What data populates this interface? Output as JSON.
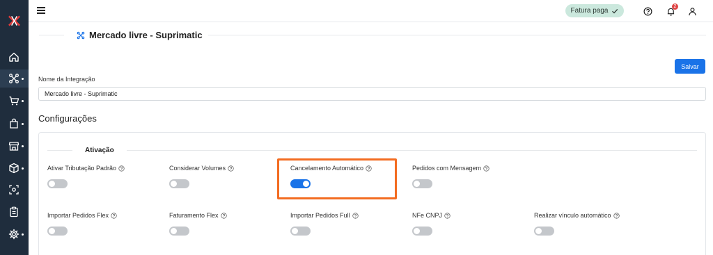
{
  "sidebar": {
    "logo": "x-logo",
    "items": [
      {
        "icon": "home-icon",
        "active": false,
        "dot": false
      },
      {
        "icon": "integrations-icon",
        "active": true,
        "dot": true
      },
      {
        "icon": "cart-icon",
        "active": false,
        "dot": true
      },
      {
        "icon": "bag-icon",
        "active": false,
        "dot": true
      },
      {
        "icon": "store-icon",
        "active": false,
        "dot": true
      },
      {
        "icon": "box-icon",
        "active": false,
        "dot": true
      },
      {
        "icon": "scan-icon",
        "active": false,
        "dot": false
      },
      {
        "icon": "clipboard-icon",
        "active": false,
        "dot": false
      },
      {
        "icon": "gear-icon",
        "active": false,
        "dot": true
      }
    ]
  },
  "topbar": {
    "status_badge": "Fatura paga",
    "notifications_count": "2"
  },
  "page": {
    "title": "Mercado livre - Suprimatic",
    "save_label": "Salvar",
    "integration_name_label": "Nome da Integração",
    "integration_name_value": "Mercado livre - Suprimatic",
    "settings_title": "Configurações",
    "group_title": "Ativação"
  },
  "options": [
    {
      "label": "Ativar Tributação Padrão",
      "enabled": false
    },
    {
      "label": "Considerar Volumes",
      "enabled": false
    },
    {
      "label": "Cancelamento Automático",
      "enabled": true
    },
    {
      "label": "Pedidos com Mensagem",
      "enabled": false
    },
    {
      "label": "Importar Pedidos Flex",
      "enabled": false
    },
    {
      "label": "Faturamento Flex",
      "enabled": false
    },
    {
      "label": "Importar Pedidos Full",
      "enabled": false
    },
    {
      "label": "NFe CNPJ",
      "enabled": false
    },
    {
      "label": "Realizar vínculo automático",
      "enabled": false
    }
  ],
  "colors": {
    "sidebar_bg": "#1f2d3d",
    "accent": "#1a73e8",
    "highlight": "#f36c21",
    "badge_bg": "#cbe8dd"
  }
}
